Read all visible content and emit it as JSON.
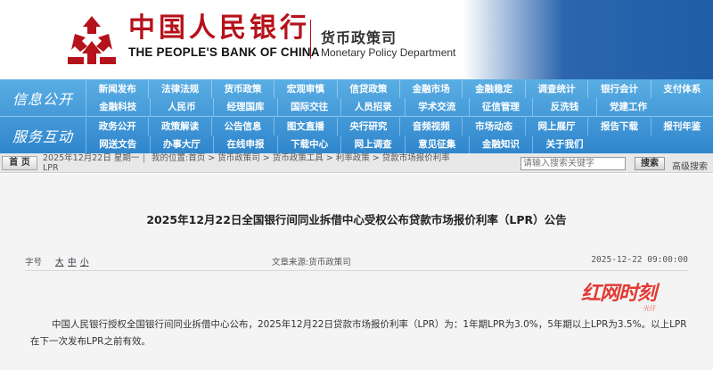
{
  "header": {
    "bank_name_cn": "中国人民银行",
    "bank_name_en": "THE PEOPLE'S BANK OF CHINA",
    "dept_cn": "货币政策司",
    "dept_en": "Monetary Policy Department",
    "brand_color": "#b5121b"
  },
  "nav": {
    "section_1": "信息公开",
    "section_2": "服务互动",
    "rows": [
      [
        "新闻发布",
        "法律法规",
        "货币政策",
        "宏观审慎",
        "信贷政策",
        "金融市场",
        "金融稳定",
        "调查统计",
        "银行会计",
        "支付体系"
      ],
      [
        "金融科技",
        "人民币",
        "经理国库",
        "国际交往",
        "人员招录",
        "学术交流",
        "征信管理",
        "反洗钱",
        "党建工作"
      ],
      [
        "政务公开",
        "政策解读",
        "公告信息",
        "图文直播",
        "央行研究",
        "音频视频",
        "市场动态",
        "网上展厅",
        "报告下载",
        "报刊年鉴"
      ],
      [
        "网送文告",
        "办事大厅",
        "在线申报",
        "下载中心",
        "网上调查",
        "意见征集",
        "金融知识",
        "关于我们"
      ]
    ]
  },
  "bar": {
    "home_label": "首 页",
    "date": "2025年12月22日 星期一",
    "separator": "|",
    "breadcrumb": "我的位置:首页 > 货币政策司 > 货币政策工具 > 利率政策 > 贷款市场报价利率",
    "breadcrumb_tail": "LPR",
    "search_placeholder": "请输入搜索关键字",
    "search_button": "搜索",
    "advanced_search": "高级搜索"
  },
  "article": {
    "title": "2025年12月22日全国银行间同业拆借中心受权公布贷款市场报价利率（LPR）公告",
    "font_size_label": "字号",
    "font_sizes": [
      "大",
      "中",
      "小"
    ],
    "source": "文章来源:货币政策司",
    "publish_time": "2025-12-22 09:00:00",
    "body": "中国人民银行授权全国银行间同业拆借中心公布，2025年12月22日贷款市场报价利率（LPR）为：1年期LPR为3.0%，5年期以上LPR为3.5%。以上LPR在下一次发布LPR之前有效。"
  },
  "watermark": {
    "main": "红网时刻",
    "small": "·光仔"
  }
}
